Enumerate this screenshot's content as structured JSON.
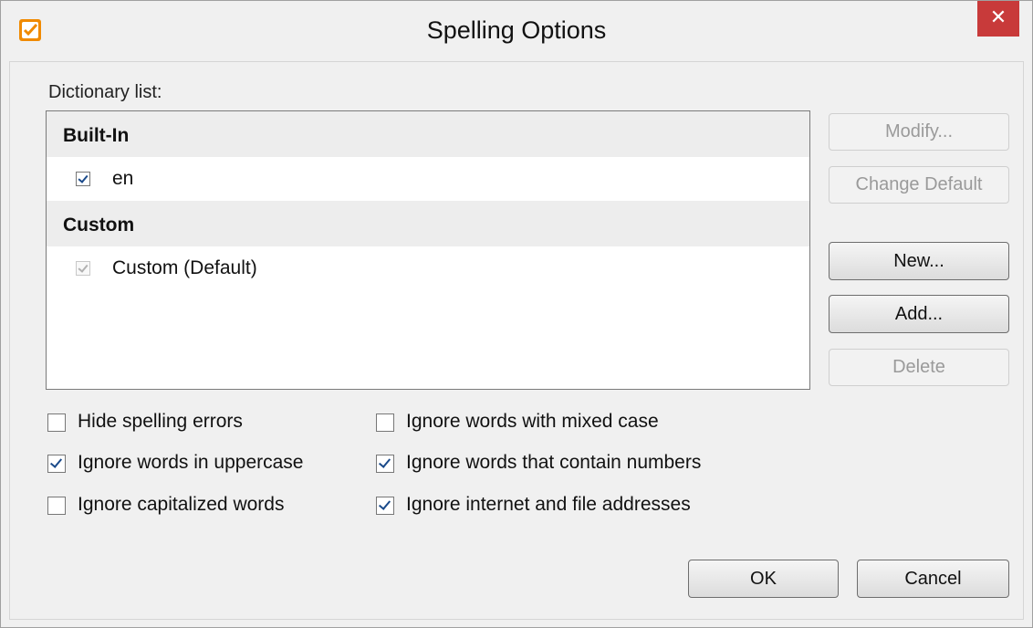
{
  "window": {
    "title": "Spelling Options",
    "close_glyph": "✕"
  },
  "dictionary": {
    "label": "Dictionary list:",
    "groups": [
      {
        "name": "Built-In",
        "items": [
          {
            "label": "en",
            "checked": true,
            "enabled": true
          }
        ]
      },
      {
        "name": "Custom",
        "items": [
          {
            "label": "Custom (Default)",
            "checked": true,
            "enabled": false
          }
        ]
      }
    ]
  },
  "side_buttons": {
    "modify": {
      "label": "Modify...",
      "enabled": false
    },
    "change_default": {
      "label": "Change Default",
      "enabled": false
    },
    "new": {
      "label": "New...",
      "enabled": true
    },
    "add": {
      "label": "Add...",
      "enabled": true
    },
    "delete": {
      "label": "Delete",
      "enabled": false
    }
  },
  "options": {
    "hide_spelling_errors": {
      "label": "Hide spelling errors",
      "checked": false
    },
    "ignore_uppercase": {
      "label": "Ignore words in uppercase",
      "checked": true
    },
    "ignore_capitalized": {
      "label": "Ignore capitalized words",
      "checked": false
    },
    "ignore_mixed_case": {
      "label": "Ignore words with mixed case",
      "checked": false
    },
    "ignore_numbers": {
      "label": "Ignore words that contain numbers",
      "checked": true
    },
    "ignore_internet": {
      "label": "Ignore internet and file addresses",
      "checked": true
    }
  },
  "footer": {
    "ok_label": "OK",
    "cancel_label": "Cancel"
  },
  "colors": {
    "app_icon": "#f08a00",
    "close_button": "#c83a3a",
    "check_mark": "#1a4a8a"
  },
  "icons": {
    "app": "orange-checkmark-icon",
    "close": "close-icon"
  }
}
